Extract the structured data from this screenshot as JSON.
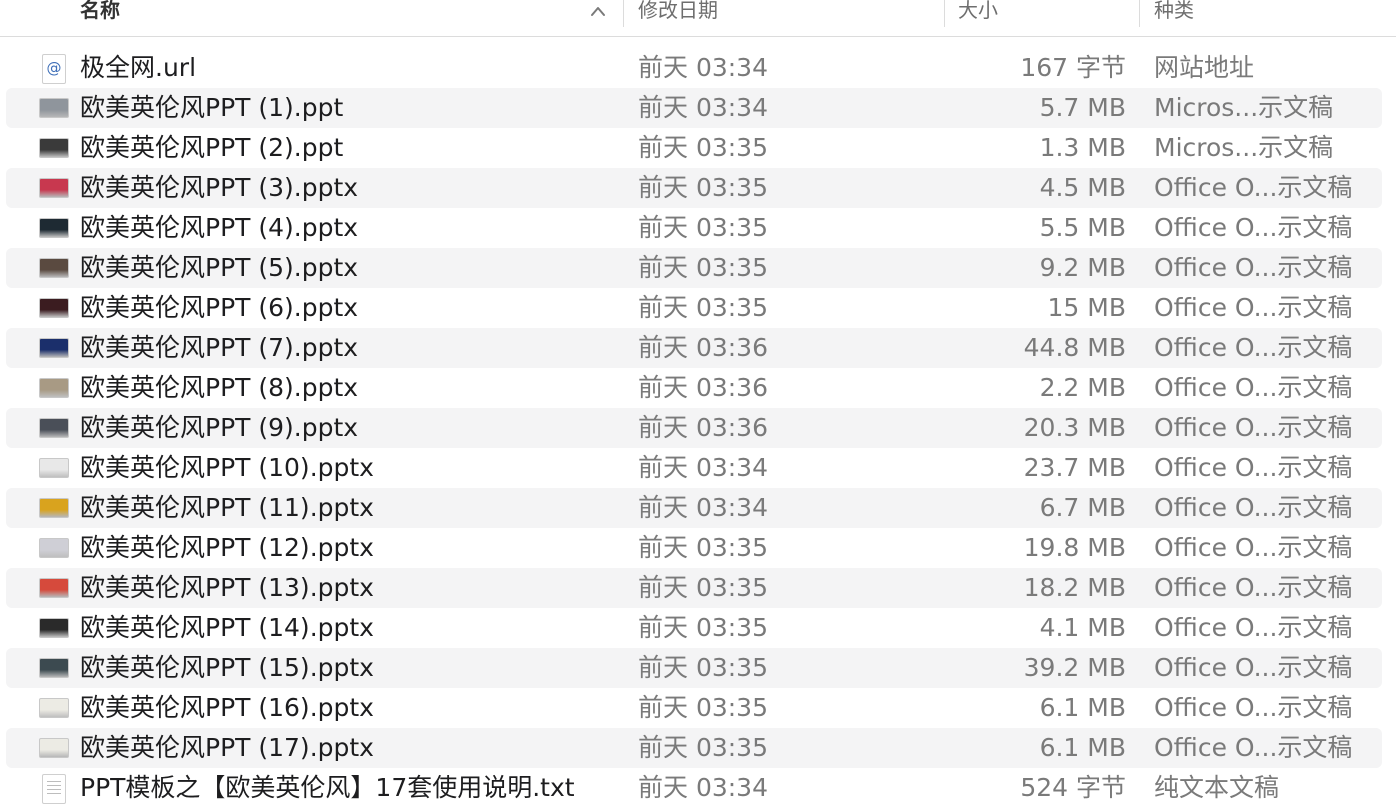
{
  "header": {
    "name": "名称",
    "date": "修改日期",
    "size": "大小",
    "kind": "种类",
    "sort_icon": "chevron-up-icon"
  },
  "colors": {
    "alt_row": "#f4f4f5",
    "secondary_text": "#7a7a7a"
  },
  "files": [
    {
      "name": "极全网.url",
      "date": "前天 03:34",
      "size": "167 字节",
      "kind": "网站地址",
      "icon": "url-document-icon",
      "thumb": "#ffffff"
    },
    {
      "name": "欧美英伦风PPT (1).ppt",
      "date": "前天 03:34",
      "size": "5.7 MB",
      "kind": "Micros...示文稿",
      "icon": "ppt-thumbnail-icon",
      "thumb": "#8f959c"
    },
    {
      "name": "欧美英伦风PPT (2).ppt",
      "date": "前天 03:35",
      "size": "1.3 MB",
      "kind": "Micros...示文稿",
      "icon": "ppt-thumbnail-icon",
      "thumb": "#3a3a3a"
    },
    {
      "name": "欧美英伦风PPT (3).pptx",
      "date": "前天 03:35",
      "size": "4.5 MB",
      "kind": "Office O...示文稿",
      "icon": "pptx-thumbnail-icon",
      "thumb": "#c8384f"
    },
    {
      "name": "欧美英伦风PPT (4).pptx",
      "date": "前天 03:35",
      "size": "5.5 MB",
      "kind": "Office O...示文稿",
      "icon": "pptx-thumbnail-icon",
      "thumb": "#1e2a33"
    },
    {
      "name": "欧美英伦风PPT (5).pptx",
      "date": "前天 03:35",
      "size": "9.2 MB",
      "kind": "Office O...示文稿",
      "icon": "pptx-thumbnail-icon",
      "thumb": "#5a4a40"
    },
    {
      "name": "欧美英伦风PPT (6).pptx",
      "date": "前天 03:35",
      "size": "15 MB",
      "kind": "Office O...示文稿",
      "icon": "pptx-thumbnail-icon",
      "thumb": "#3b1c20"
    },
    {
      "name": "欧美英伦风PPT (7).pptx",
      "date": "前天 03:36",
      "size": "44.8 MB",
      "kind": "Office O...示文稿",
      "icon": "pptx-thumbnail-icon",
      "thumb": "#1b2f6b"
    },
    {
      "name": "欧美英伦风PPT (8).pptx",
      "date": "前天 03:36",
      "size": "2.2 MB",
      "kind": "Office O...示文稿",
      "icon": "pptx-thumbnail-icon",
      "thumb": "#a89a84"
    },
    {
      "name": "欧美英伦风PPT (9).pptx",
      "date": "前天 03:36",
      "size": "20.3 MB",
      "kind": "Office O...示文稿",
      "icon": "pptx-thumbnail-icon",
      "thumb": "#4a4f58"
    },
    {
      "name": "欧美英伦风PPT (10).pptx",
      "date": "前天 03:34",
      "size": "23.7 MB",
      "kind": "Office O...示文稿",
      "icon": "pptx-thumbnail-icon",
      "thumb": "#e8e8e8"
    },
    {
      "name": "欧美英伦风PPT (11).pptx",
      "date": "前天 03:34",
      "size": "6.7 MB",
      "kind": "Office O...示文稿",
      "icon": "pptx-thumbnail-icon",
      "thumb": "#d9a31e"
    },
    {
      "name": "欧美英伦风PPT (12).pptx",
      "date": "前天 03:35",
      "size": "19.8 MB",
      "kind": "Office O...示文稿",
      "icon": "pptx-thumbnail-icon",
      "thumb": "#cfcfd6"
    },
    {
      "name": "欧美英伦风PPT (13).pptx",
      "date": "前天 03:35",
      "size": "18.2 MB",
      "kind": "Office O...示文稿",
      "icon": "pptx-thumbnail-icon",
      "thumb": "#d64a3c"
    },
    {
      "name": "欧美英伦风PPT (14).pptx",
      "date": "前天 03:35",
      "size": "4.1 MB",
      "kind": "Office O...示文稿",
      "icon": "pptx-thumbnail-icon",
      "thumb": "#2a2a2a"
    },
    {
      "name": "欧美英伦风PPT (15).pptx",
      "date": "前天 03:35",
      "size": "39.2 MB",
      "kind": "Office O...示文稿",
      "icon": "pptx-thumbnail-icon",
      "thumb": "#3c4a50"
    },
    {
      "name": "欧美英伦风PPT (16).pptx",
      "date": "前天 03:35",
      "size": "6.1 MB",
      "kind": "Office O...示文稿",
      "icon": "pptx-thumbnail-icon",
      "thumb": "#ecebe4"
    },
    {
      "name": "欧美英伦风PPT (17).pptx",
      "date": "前天 03:35",
      "size": "6.1 MB",
      "kind": "Office O...示文稿",
      "icon": "pptx-thumbnail-icon",
      "thumb": "#ecebe4"
    },
    {
      "name": "PPT模板之【欧美英伦风】17套使用说明.txt",
      "date": "前天 03:34",
      "size": "524 字节",
      "kind": "纯文本文稿",
      "icon": "text-document-icon",
      "thumb": "#ffffff"
    }
  ]
}
